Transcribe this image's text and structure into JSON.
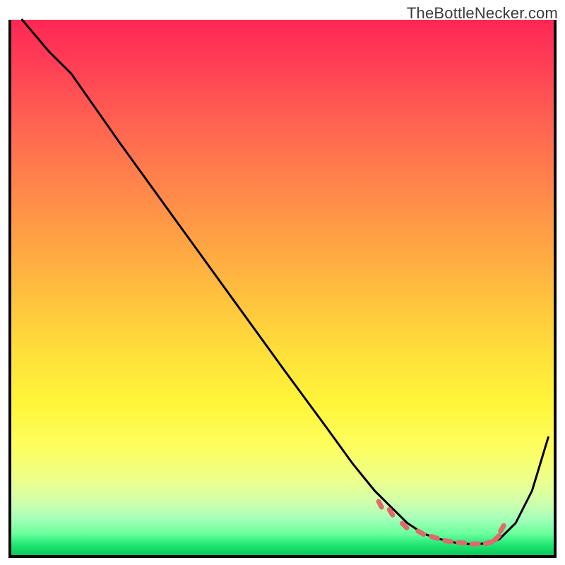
{
  "watermark": "TheBottleNecker.com",
  "chart_data": {
    "type": "line",
    "title": "",
    "xlabel": "",
    "ylabel": "",
    "xlim": [
      0,
      100
    ],
    "ylim": [
      0,
      100
    ],
    "series": [
      {
        "name": "bottleneck-curve",
        "color": "#000000",
        "x": [
          2,
          7,
          11,
          20,
          30,
          40,
          50,
          58,
          63,
          67,
          70,
          73,
          76,
          79,
          82,
          85,
          88,
          90,
          93,
          96,
          99
        ],
        "y": [
          100,
          94,
          90,
          77,
          63,
          49,
          35,
          24,
          17,
          12,
          9,
          6,
          4,
          3,
          2.3,
          2,
          2.2,
          3,
          6,
          12,
          22
        ]
      }
    ],
    "markers": {
      "name": "optimal-zone",
      "color": "#e06a6a",
      "shape": "rounded-bar",
      "x": [
        68,
        70,
        72.5,
        75.5,
        78,
        80.5,
        83,
        85.5,
        88,
        89.5,
        90.5
      ],
      "y": [
        9.5,
        8,
        5.5,
        4.2,
        3.3,
        2.6,
        2.3,
        2.1,
        2.3,
        3.2,
        5
      ],
      "angle_deg": [
        62,
        58,
        45,
        30,
        18,
        10,
        3,
        -3,
        -15,
        -45,
        -60
      ]
    },
    "background_gradient": {
      "top": "#ff2655",
      "mid": "#ffe13a",
      "bottom": "#08c958"
    }
  }
}
